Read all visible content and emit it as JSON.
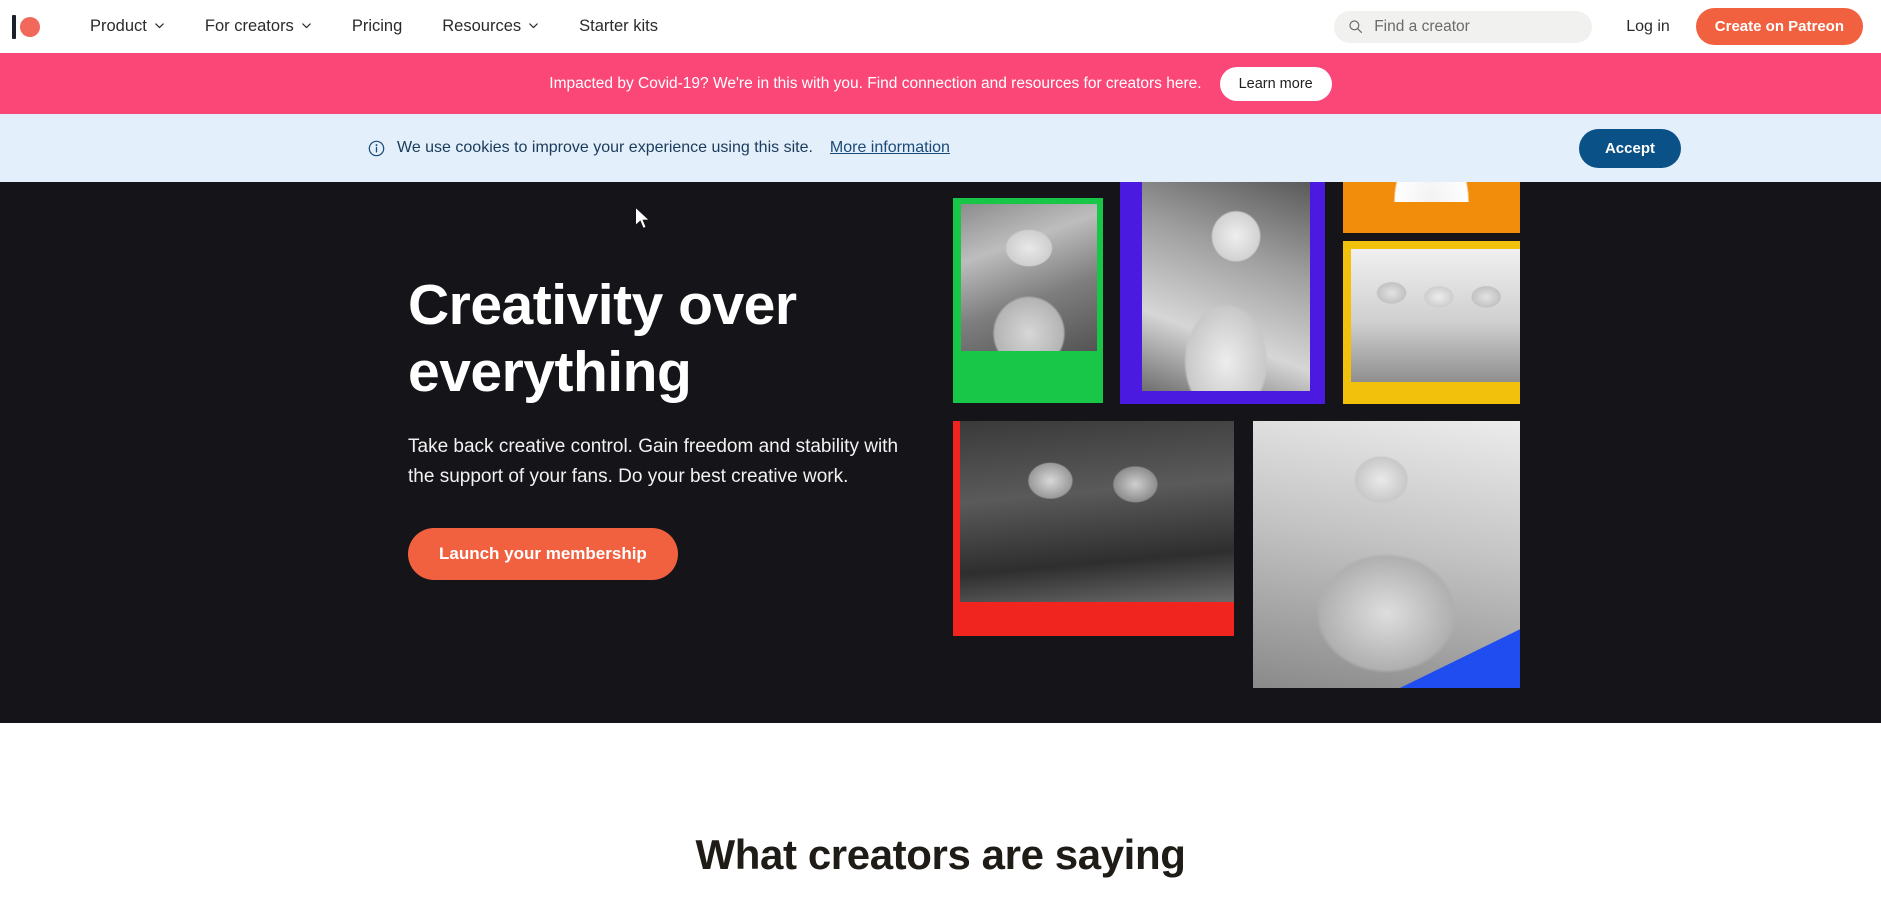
{
  "nav": {
    "logo_name": "patreon-logo",
    "items": [
      {
        "label": "Product",
        "has_caret": true
      },
      {
        "label": "For creators",
        "has_caret": true
      },
      {
        "label": "Pricing",
        "has_caret": false
      },
      {
        "label": "Resources",
        "has_caret": true
      },
      {
        "label": "Starter kits",
        "has_caret": false
      }
    ],
    "search": {
      "placeholder": "Find a creator",
      "value": "",
      "icon": "search-icon"
    },
    "login_label": "Log in",
    "create_label": "Create on Patreon"
  },
  "covid_banner": {
    "text": "Impacted by Covid-19? We're in this with you. Find connection and resources for creators here.",
    "button_label": "Learn more",
    "background": "#fa4778"
  },
  "cookie_bar": {
    "icon": "info-icon",
    "text": "We use cookies to improve your experience using this site.",
    "link_label": "More information",
    "accept_label": "Accept",
    "background": "#e3effa",
    "accept_color": "#0a5188"
  },
  "hero": {
    "title": "Creativity over everything",
    "subtitle": "Take back creative control. Gain freedom and stability with the support of your fans. Do your best creative work.",
    "cta_label": "Launch your membership",
    "background": "#141419",
    "cta_color": "#f1603f",
    "photos": [
      {
        "name": "photo-creator-plants",
        "accent": "#18c648",
        "alt": "Creator with glasses in a plant-filled studio"
      },
      {
        "name": "photo-creator-desk",
        "accent": "#4b1ae0",
        "alt": "Blonde creator at her desk"
      },
      {
        "name": "photo-creator-orange",
        "accent": "#f28c0b",
        "alt": "Creator portrait on orange"
      },
      {
        "name": "photo-creator-trio",
        "accent": "#f2c10b",
        "alt": "Three creators standing together"
      },
      {
        "name": "photo-podcasters",
        "accent": "#f0251f",
        "alt": "Two podcasters with headphones and microphones"
      },
      {
        "name": "photo-guitarist",
        "accent": "#1f4df0",
        "alt": "Musician playing acoustic guitar on a balcony"
      }
    ]
  },
  "testimonials": {
    "heading": "What creators are saying"
  }
}
